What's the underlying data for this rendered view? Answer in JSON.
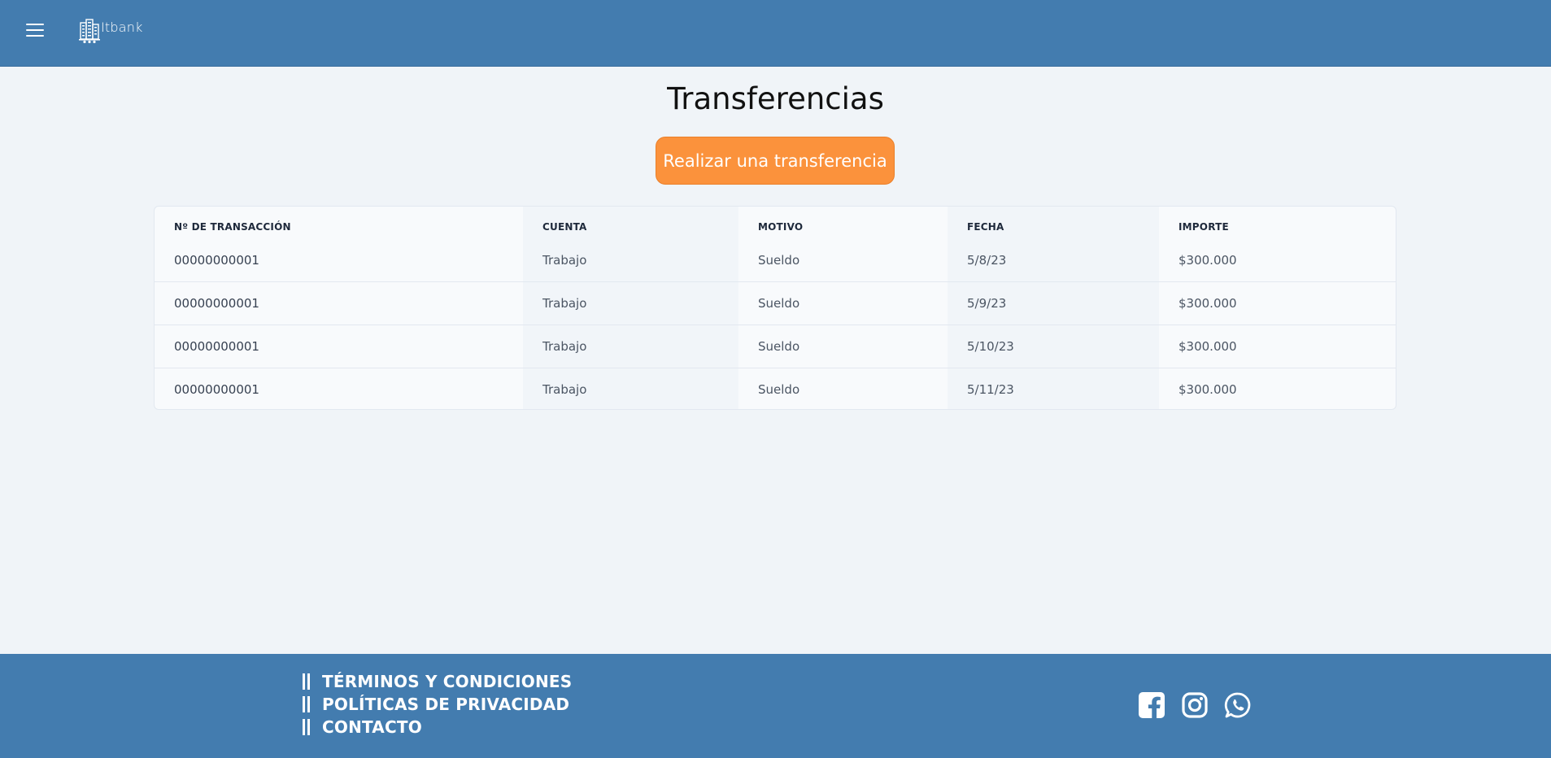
{
  "header": {
    "menu_icon": "hamburger-icon",
    "logo_text": "Itbank",
    "logo_icon": "buildings-icon",
    "brand_color": "#437caf"
  },
  "main": {
    "title": "Transferencias",
    "cta_label": "Realizar una transferencia",
    "cta_color": "#fb923c"
  },
  "table": {
    "headers": [
      "Nº DE TRANSACCIÓN",
      "CUENTA",
      "MOTIVO",
      "FECHA",
      "IMPORTE"
    ],
    "rows": [
      {
        "id": "00000000001",
        "account": "Trabajo",
        "reason": "Sueldo",
        "date": "5/8/23",
        "amount": "$300.000"
      },
      {
        "id": "00000000001",
        "account": "Trabajo",
        "reason": "Sueldo",
        "date": "5/9/23",
        "amount": "$300.000"
      },
      {
        "id": "00000000001",
        "account": "Trabajo",
        "reason": "Sueldo",
        "date": "5/10/23",
        "amount": "$300.000"
      },
      {
        "id": "00000000001",
        "account": "Trabajo",
        "reason": "Sueldo",
        "date": "5/11/23",
        "amount": "$300.000"
      }
    ]
  },
  "footer": {
    "links": [
      "TÉRMINOS Y CONDICIONES",
      "POLÍTICAS DE PRIVACIDAD",
      "CONTACTO"
    ],
    "social_icons": [
      "facebook-icon",
      "instagram-icon",
      "whatsapp-icon"
    ]
  }
}
